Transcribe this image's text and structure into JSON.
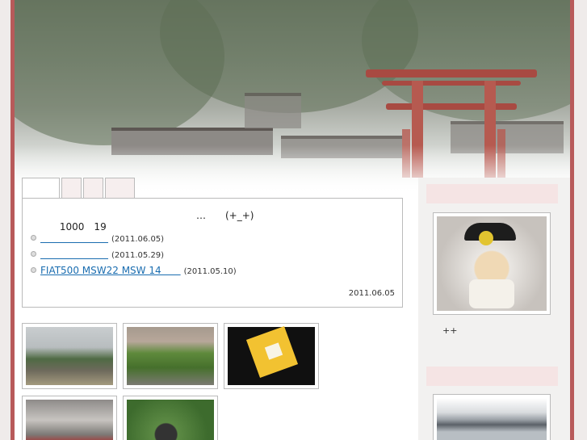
{
  "post": {
    "title_left": "1000　19",
    "title_right": "…　　(+_+)",
    "links": [
      {
        "text": "　　　　　　　",
        "date": "(2011.06.05)"
      },
      {
        "text": "　　　　　　　",
        "date": "(2011.05.29)"
      },
      {
        "text": "FIAT500 MSW22 MSW 14　　",
        "date": "(2011.05.10)"
      }
    ],
    "date": "2011.06.05"
  },
  "sidebar": {
    "caption": "++"
  },
  "colors": {
    "frame_border": "#b85a5a",
    "link": "#1a6db0",
    "sidebar_head": "#f5e4e4",
    "sidebar_bg": "#f2f1f0"
  }
}
